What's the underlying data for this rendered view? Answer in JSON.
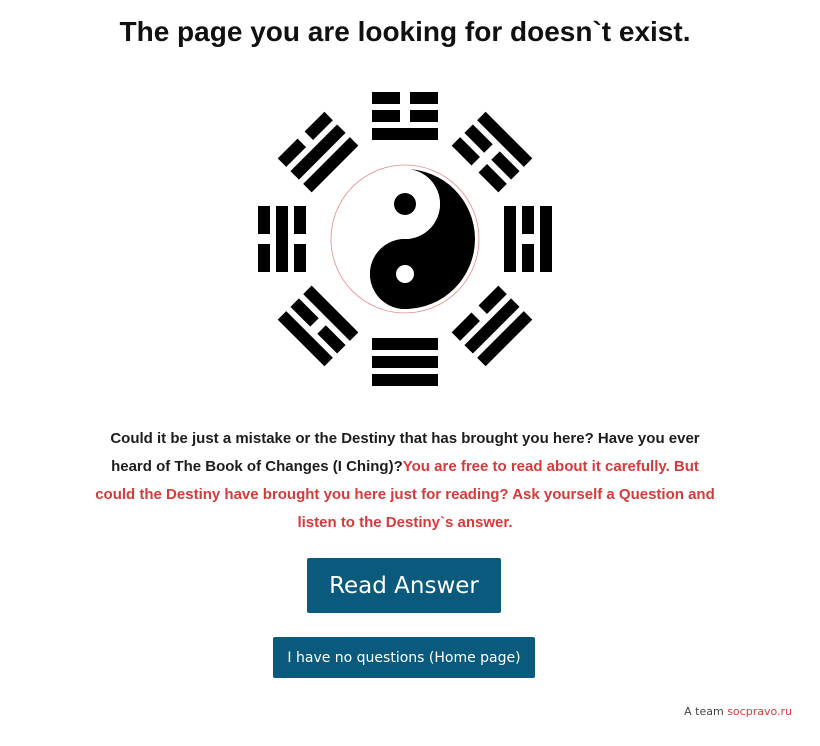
{
  "page": {
    "title": "The page you are looking for doesn`t exist."
  },
  "image": {
    "icon": "bagua-yin-yang-icon"
  },
  "message": {
    "part1": "Could it be just a mistake or the Destiny that has brought you here? Have you ever heard of The Book of Changes (I Ching)?",
    "part2": "You are free to read about it carefully. But could the Destiny have brought you here just for reading? Ask yourself a Question and listen to the Destiny`s answer."
  },
  "buttons": {
    "read_answer": "Read Answer",
    "home": "I have no questions (Home page)"
  },
  "footer": {
    "prefix": "A team ",
    "link": "socpravo.ru"
  },
  "colors": {
    "accent_red": "#d63a3a",
    "button_blue": "#0a5a7e"
  }
}
